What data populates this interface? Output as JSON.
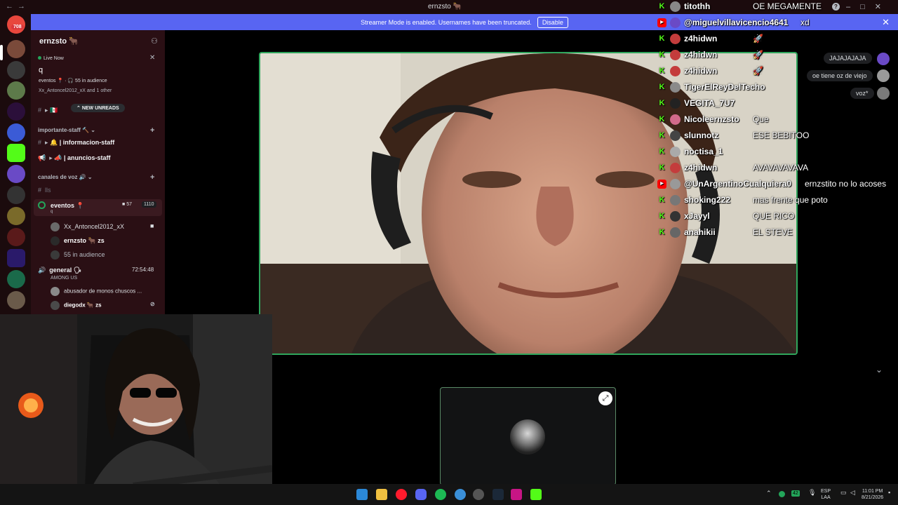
{
  "window": {
    "title": "ernzsto 🐂",
    "nav_back": "←",
    "nav_forward": "→",
    "help": "?",
    "controls": [
      "–",
      "□",
      "✕"
    ]
  },
  "banner": {
    "text": "Streamer Mode is enabled. Usernames have been truncated.",
    "disable_label": "Disable",
    "close": "✕"
  },
  "rail": {
    "mention_badge": "708"
  },
  "channels": {
    "server_name": "ernzsto 🐂",
    "live_label": "Live Now",
    "live_channel_letter": "q",
    "live_stage": "eventos 📍 · 🎧 55 in audience",
    "live_people": "Xx_Antoncel2012_xX and 1 other",
    "new_unreads": "NEW UNREADS",
    "categories": [
      {
        "label": "importante-staff 🔨",
        "plus": "+"
      },
      {
        "label": "canales de voz 🔊",
        "plus": "+"
      }
    ],
    "staff_channels": [
      "🔔 | informacion-staff",
      "📣 | anuncios-staff"
    ],
    "voice_channel_lls": "lls",
    "events": {
      "name": "eventos 📍",
      "sub": "q",
      "count_a": "57",
      "count_b": "1110",
      "members": [
        "Xx_Antoncel2012_xX",
        "ernzsto 🐂 zs"
      ],
      "audience": "55 in audience"
    },
    "general": {
      "name": "general 🗣",
      "sub": "AMONG US",
      "timer": "72:54:48",
      "members": [
        "abusador de monos chuscos ...",
        "diegodx 🐂 zs"
      ]
    }
  },
  "stream": {
    "expand_caret": "⌄",
    "tile_icon": "⤢"
  },
  "chat_overlay": {
    "messages": [
      {
        "platform": "K",
        "user": "titothh",
        "text": "OE MEGAMENTE",
        "text_x": 136
      },
      {
        "platform": "YT",
        "user": "@miguelvillavicencio4641",
        "text": "xd",
        "text_x": 204
      },
      {
        "platform": "K",
        "user": "z4hidwn",
        "text": "🚀",
        "text_x": 136
      },
      {
        "platform": "K",
        "user": "z4hidwn",
        "text": "🚀",
        "text_x": 136
      },
      {
        "platform": "K",
        "user": "z4hidwn",
        "text": "🚀",
        "text_x": 136
      },
      {
        "platform": "K",
        "user": "TigerElReyDelTecho",
        "text": "",
        "text_x": 136
      },
      {
        "platform": "K",
        "user": "VEGITA_7U7",
        "text": "",
        "text_x": 136
      },
      {
        "platform": "K",
        "user": "Nicoleernzsto",
        "text": "Que",
        "text_x": 136
      },
      {
        "platform": "K",
        "user": "slunnotz",
        "text": "ESE BEBITOO",
        "text_x": 136
      },
      {
        "platform": "K",
        "user": "noctisa_1",
        "text": "",
        "text_x": 136
      },
      {
        "platform": "K",
        "user": "z4hidwn",
        "text": "AVAVAVAVAVA",
        "text_x": 136
      },
      {
        "platform": "YT",
        "user": "@UnArgentinoCualquiera0",
        "text": "ernzstito no lo acoses",
        "text_x": 210
      },
      {
        "platform": "K",
        "user": "shoking222",
        "text": "mas frente que poto",
        "text_x": 136
      },
      {
        "platform": "K",
        "user": "xJayyl",
        "text": "QUE RICO",
        "text_x": 136
      },
      {
        "platform": "K",
        "user": "anahikii",
        "text": "EL STEVE",
        "text_x": 136
      }
    ]
  },
  "side_messages": [
    "JAJAJAJAJA",
    "oe tiene oz de viejo",
    "voz*"
  ],
  "taskbar": {
    "lang_top": "ESP",
    "lang_bottom": "LAA",
    "time": "11:01 PM",
    "date": "8/21/2026",
    "net_badge": "42"
  }
}
